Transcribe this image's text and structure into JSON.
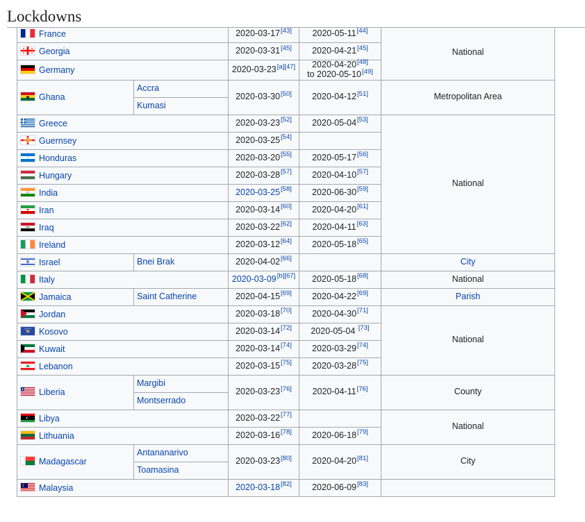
{
  "heading": "Lockdowns",
  "colors": {
    "link": "#0645ad",
    "border": "#a2a9b1",
    "table_bg": "#f8f9fa"
  },
  "rows": {
    "france": {
      "country": "France",
      "start": "2020-03-17",
      "start_ref": "[43]",
      "end": "2020-05-11",
      "end_ref": "[44]",
      "flag_icon": "france-flag-icon"
    },
    "georgia": {
      "country": "Georgia",
      "start": "2020-03-31",
      "start_ref": "[45]",
      "end": "2020-04-21",
      "end_ref": "[45]",
      "flag_icon": "georgia-flag-icon"
    },
    "germany": {
      "country": "Germany",
      "start": "2020-03-23",
      "start_ref": "[a][47]",
      "end_line1": "2020-04-20",
      "end_ref1": "[48]",
      "end_line2": "to 2020-05-10",
      "end_ref2": "[49]",
      "flag_icon": "germany-flag-icon"
    },
    "ghana": {
      "country": "Ghana",
      "region1": "Accra",
      "region2": "Kumasi",
      "start": "2020-03-30",
      "start_ref": "[50]",
      "end": "2020-04-12",
      "end_ref": "[51]",
      "level": "Metropolitan Area",
      "flag_icon": "ghana-flag-icon"
    },
    "greece": {
      "country": "Greece",
      "start": "2020-03-23",
      "start_ref": "[52]",
      "end": "2020-05-04",
      "end_ref": "[53]",
      "flag_icon": "greece-flag-icon"
    },
    "guernsey": {
      "country": "Guernsey",
      "start": "2020-03-25",
      "start_ref": "[54]",
      "flag_icon": "guernsey-flag-icon"
    },
    "honduras": {
      "country": "Honduras",
      "start": "2020-03-20",
      "start_ref": "[55]",
      "end": "2020-05-17",
      "end_ref": "[56]",
      "flag_icon": "honduras-flag-icon"
    },
    "hungary": {
      "country": "Hungary",
      "start": "2020-03-28",
      "start_ref": "[57]",
      "end": "2020-04-10",
      "end_ref": "[57]",
      "flag_icon": "hungary-flag-icon"
    },
    "india": {
      "country": "India",
      "start": "2020-03-25",
      "start_ref": "[58]",
      "end": "2020-06-30",
      "end_ref": "[59]",
      "flag_icon": "india-flag-icon"
    },
    "iran": {
      "country": "Iran",
      "start": "2020-03-14",
      "start_ref": "[60]",
      "end": "2020-04-20",
      "end_ref": "[61]",
      "flag_icon": "iran-flag-icon"
    },
    "iraq": {
      "country": "Iraq",
      "start": "2020-03-22",
      "start_ref": "[62]",
      "end": "2020-04-11",
      "end_ref": "[63]",
      "flag_icon": "iraq-flag-icon"
    },
    "ireland": {
      "country": "Ireland",
      "start": "2020-03-12",
      "start_ref": "[64]",
      "end": "2020-05-18",
      "end_ref": "[65]",
      "flag_icon": "ireland-flag-icon"
    },
    "israel": {
      "country": "Israel",
      "region": "Bnei Brak",
      "start": "2020-04-02",
      "start_ref": "[66]",
      "level": "City",
      "flag_icon": "israel-flag-icon"
    },
    "italy": {
      "country": "Italy",
      "start": "2020-03-09",
      "start_ref": "[b][67]",
      "end": "2020-05-18",
      "end_ref": "[68]",
      "level": "National",
      "flag_icon": "italy-flag-icon"
    },
    "jamaica": {
      "country": "Jamaica",
      "region": "Saint Catherine",
      "start": "2020-04-15",
      "start_ref": "[69]",
      "end": "2020-04-22",
      "end_ref": "[69]",
      "level": "Parish",
      "flag_icon": "jamaica-flag-icon"
    },
    "jordan": {
      "country": "Jordan",
      "start": "2020-03-18",
      "start_ref": "[70]",
      "end": "2020-04-30",
      "end_ref": "[71]",
      "flag_icon": "jordan-flag-icon"
    },
    "kosovo": {
      "country": "Kosovo",
      "start": "2020-03-14",
      "start_ref": "[72]",
      "end": "2020-05-04",
      "end_ref": "[73]",
      "flag_icon": "kosovo-flag-icon"
    },
    "kuwait": {
      "country": "Kuwait",
      "start": "2020-03-14",
      "start_ref": "[74]",
      "end": "2020-03-29",
      "end_ref": "[74]",
      "flag_icon": "kuwait-flag-icon"
    },
    "lebanon": {
      "country": "Lebanon",
      "start": "2020-03-15",
      "start_ref": "[75]",
      "end": "2020-03-28",
      "end_ref": "[75]",
      "flag_icon": "lebanon-flag-icon"
    },
    "liberia": {
      "country": "Liberia",
      "region1": "Margibi",
      "region2": "Montserrado",
      "start": "2020-03-23",
      "start_ref": "[76]",
      "end": "2020-04-11",
      "end_ref": "[76]",
      "level": "County",
      "flag_icon": "liberia-flag-icon"
    },
    "libya": {
      "country": "Libya",
      "start": "2020-03-22",
      "start_ref": "[77]",
      "flag_icon": "libya-flag-icon"
    },
    "lithuania": {
      "country": "Lithuania",
      "start": "2020-03-16",
      "start_ref": "[78]",
      "end": "2020-06-18",
      "end_ref": "[79]",
      "flag_icon": "lithuania-flag-icon"
    },
    "madagascar": {
      "country": "Madagascar",
      "region1": "Antananarivo",
      "region2": "Toamasina",
      "start": "2020-03-23",
      "start_ref": "[80]",
      "end": "2020-04-20",
      "end_ref": "[81]",
      "level": "City",
      "flag_icon": "madagascar-flag-icon"
    },
    "malaysia": {
      "country": "Malaysia",
      "start": "2020-03-18",
      "start_ref": "[82]",
      "end": "2020-06-09",
      "end_ref": "[83]",
      "flag_icon": "malaysia-flag-icon"
    }
  },
  "levels": {
    "national_top": "National",
    "national_mid": "National",
    "national_low": "National",
    "national_bottom": "National"
  }
}
